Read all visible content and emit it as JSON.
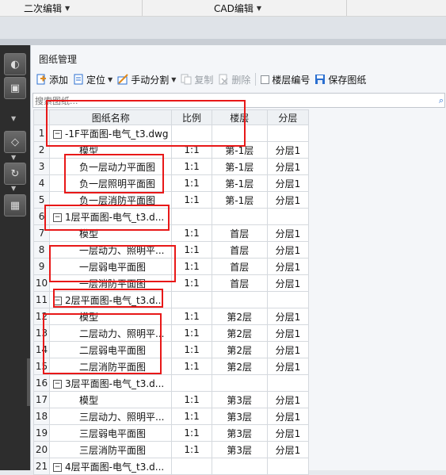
{
  "ribbon": {
    "tab1": "二次编辑",
    "tab2": "CAD编辑"
  },
  "panel": {
    "title": "图纸管理",
    "toolbar": {
      "add": "添加",
      "locate": "定位",
      "manual_split": "手动分割",
      "copy": "复制",
      "delete": "删除",
      "floor_number": "楼层编号",
      "save": "保存图纸"
    },
    "search_placeholder": "搜索图纸..."
  },
  "table": {
    "headers": [
      "图纸名称",
      "比例",
      "楼层",
      "分层"
    ],
    "rows": [
      {
        "idx": "1",
        "name": "-1F平面图-电气_t3.dwg",
        "group": true
      },
      {
        "idx": "2",
        "name": "模型",
        "scale": "1:1",
        "floor": "第-1层",
        "layer": "分层1"
      },
      {
        "idx": "3",
        "name": "负一层动力平面图",
        "scale": "1:1",
        "floor": "第-1层",
        "layer": "分层1"
      },
      {
        "idx": "4",
        "name": "负一层照明平面图",
        "scale": "1:1",
        "floor": "第-1层",
        "layer": "分层1"
      },
      {
        "idx": "5",
        "name": "负一层消防平面图",
        "scale": "1:1",
        "floor": "第-1层",
        "layer": "分层1"
      },
      {
        "idx": "6",
        "name": "1层平面图-电气_t3.d...",
        "group": true
      },
      {
        "idx": "7",
        "name": "模型",
        "scale": "1:1",
        "floor": "首层",
        "layer": "分层1"
      },
      {
        "idx": "8",
        "name": "一层动力、照明平...",
        "scale": "1:1",
        "floor": "首层",
        "layer": "分层1"
      },
      {
        "idx": "9",
        "name": "一层弱电平面图",
        "scale": "1:1",
        "floor": "首层",
        "layer": "分层1"
      },
      {
        "idx": "10",
        "name": "一层消防平面图",
        "scale": "1:1",
        "floor": "首层",
        "layer": "分层1"
      },
      {
        "idx": "11",
        "name": "2层平面图-电气_t3.d...",
        "group": true
      },
      {
        "idx": "12",
        "name": "模型",
        "scale": "1:1",
        "floor": "第2层",
        "layer": "分层1"
      },
      {
        "idx": "13",
        "name": "二层动力、照明平...",
        "scale": "1:1",
        "floor": "第2层",
        "layer": "分层1"
      },
      {
        "idx": "14",
        "name": "二层弱电平面图",
        "scale": "1:1",
        "floor": "第2层",
        "layer": "分层1"
      },
      {
        "idx": "15",
        "name": "二层消防平面图",
        "scale": "1:1",
        "floor": "第2层",
        "layer": "分层1"
      },
      {
        "idx": "16",
        "name": "3层平面图-电气_t3.d...",
        "group": true
      },
      {
        "idx": "17",
        "name": "模型",
        "scale": "1:1",
        "floor": "第3层",
        "layer": "分层1"
      },
      {
        "idx": "18",
        "name": "三层动力、照明平...",
        "scale": "1:1",
        "floor": "第3层",
        "layer": "分层1"
      },
      {
        "idx": "19",
        "name": "三层弱电平面图",
        "scale": "1:1",
        "floor": "第3层",
        "layer": "分层1"
      },
      {
        "idx": "20",
        "name": "三层消防平面图",
        "scale": "1:1",
        "floor": "第3层",
        "layer": "分层1"
      },
      {
        "idx": "21",
        "name": "4层平面图-电气_t3.d...",
        "group": true
      }
    ]
  },
  "colors": {
    "annotation": "#e81818",
    "icon_blue": "#2a6fd0",
    "icon_orange": "#e08a1c"
  }
}
